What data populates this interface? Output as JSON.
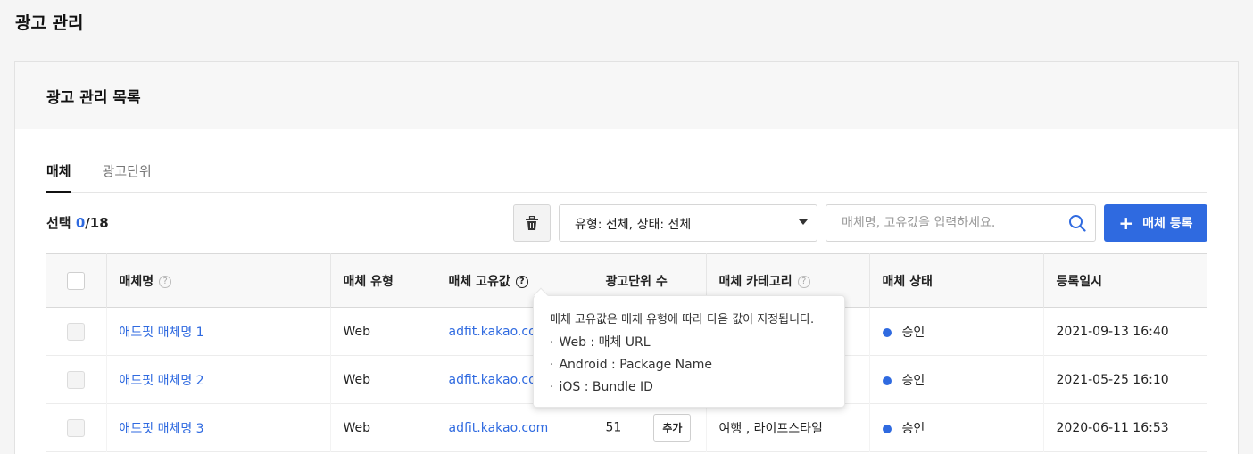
{
  "page": {
    "title": "광고 관리"
  },
  "card": {
    "title": "광고 관리 목록"
  },
  "tabs": [
    {
      "label": "매체",
      "active": true
    },
    {
      "label": "광고단위",
      "active": false
    }
  ],
  "selection": {
    "label": "선택",
    "selected": "0",
    "total": "/18"
  },
  "toolbar": {
    "filter_value": "유형: 전체, 상태: 전체",
    "search_placeholder": "매체명, 고유값을 입력하세요.",
    "add_label": "매체 등록"
  },
  "table": {
    "columns": [
      "매체명",
      "매체 유형",
      "매체 고유값",
      "광고단위 수",
      "매체 카테고리",
      "매체 상태",
      "등록일시"
    ],
    "rows": [
      {
        "name": "애드핏 매체명 1",
        "type": "Web",
        "uid": "adfit.kakao.com",
        "units": "",
        "category": "",
        "status": "승인",
        "date": "2021-09-13 16:40"
      },
      {
        "name": "애드핏 매체명 2",
        "type": "Web",
        "uid": "adfit.kakao.com",
        "units": "",
        "category": "",
        "status": "승인",
        "date": "2021-05-25 16:10"
      },
      {
        "name": "애드핏 매체명 3",
        "type": "Web",
        "uid": "adfit.kakao.com",
        "units": "51",
        "category": "여행 , 라이프스타일",
        "status": "승인",
        "date": "2020-06-11 16:53"
      }
    ],
    "add_unit_label": "추가"
  },
  "tooltip": {
    "title": "매체 고유값은 매체 유형에 따라 다음 값이 지정됩니다.",
    "lines": [
      "Web : 매체 URL",
      "Android : Package Name",
      "iOS : Bundle ID"
    ],
    "bullet": "·"
  },
  "colors": {
    "accent": "#2f6ae0",
    "status_approved": "#2f6ae0"
  },
  "icons": {
    "delete": "trash-icon",
    "search": "search-icon",
    "add": "plus-icon",
    "help": "help-circle-icon"
  }
}
